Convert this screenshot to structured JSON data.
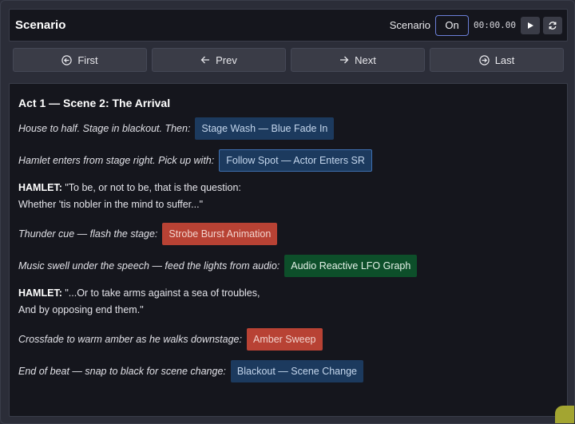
{
  "header": {
    "title": "Scenario",
    "scenario_label": "Scenario",
    "toggle_label": "On",
    "timer": "00:00.00"
  },
  "nav": {
    "first": "First",
    "prev": "Prev",
    "next": "Next",
    "last": "Last"
  },
  "scene": {
    "title": "Act 1 — Scene 2: The Arrival",
    "cues": [
      {
        "text": "House to half. Stage in blackout. Then:",
        "chip": "Stage Wash — Blue Fade In",
        "color": "#1c3a5e"
      },
      {
        "text": "Hamlet enters from stage right. Pick up with:",
        "chip": "Follow Spot — Actor Enters SR",
        "color": "#1c3a5e"
      },
      {
        "text": "Thunder cue — flash the stage:",
        "chip": "Strobe Burst Animation",
        "color": "#b84234"
      },
      {
        "text": "Music swell under the speech — feed the lights from audio:",
        "chip": "Audio Reactive LFO Graph",
        "color": "#0d4f2a"
      },
      {
        "text": "Crossfade to warm amber as he walks downstage:",
        "chip": "Amber Sweep",
        "color": "#b84234"
      },
      {
        "text": "End of beat — snap to black for scene change:",
        "chip": "Blackout — Scene Change",
        "color": "#1c3a5e"
      }
    ],
    "dialog1": {
      "speaker": "HAMLET:",
      "line1": " \"To be, or not to be, that is the question:",
      "line2": "Whether 'tis nobler in the mind to suffer...\""
    },
    "dialog2": {
      "speaker": "HAMLET:",
      "line1": " \"...Or to take arms against a sea of troubles,",
      "line2": "And by opposing end them.\""
    }
  }
}
